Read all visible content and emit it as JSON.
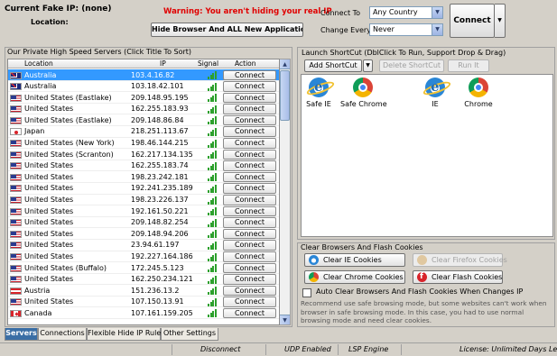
{
  "header": {
    "current_ip_label": "Current Fake IP: (none)",
    "location_label": "Location:",
    "warning": "Warning: You aren't hiding your real IP",
    "hide_browser_button": "Hide Browser And ALL New Application IP",
    "connect_to_label": "Connect To",
    "connect_to_value": "Any Country",
    "change_every_label": "Change Every",
    "change_every_value": "Never",
    "connect_button": "Connect"
  },
  "servers": {
    "title": "Our Private High Speed Servers (Click Title To Sort)",
    "columns": {
      "location": "Location",
      "ip": "IP",
      "signal": "Signal",
      "action": "Action"
    },
    "action_label": "Connect",
    "rows": [
      {
        "flag": "au",
        "location": "Australia",
        "ip": "103.4.16.82",
        "selected": true
      },
      {
        "flag": "au",
        "location": "Australia",
        "ip": "103.18.42.101"
      },
      {
        "flag": "us",
        "location": "United States (Eastlake)",
        "ip": "209.148.95.195"
      },
      {
        "flag": "us",
        "location": "United States",
        "ip": "162.255.183.93"
      },
      {
        "flag": "us",
        "location": "United States (Eastlake)",
        "ip": "209.148.86.84"
      },
      {
        "flag": "jp",
        "location": "Japan",
        "ip": "218.251.113.67"
      },
      {
        "flag": "us",
        "location": "United States (New York)",
        "ip": "198.46.144.215"
      },
      {
        "flag": "us",
        "location": "United States (Scranton)",
        "ip": "162.217.134.135"
      },
      {
        "flag": "us",
        "location": "United States",
        "ip": "162.255.183.74"
      },
      {
        "flag": "us",
        "location": "United States",
        "ip": "198.23.242.181"
      },
      {
        "flag": "us",
        "location": "United States",
        "ip": "192.241.235.189"
      },
      {
        "flag": "us",
        "location": "United States",
        "ip": "198.23.226.137"
      },
      {
        "flag": "us",
        "location": "United States",
        "ip": "192.161.50.221"
      },
      {
        "flag": "us",
        "location": "United States",
        "ip": "209.148.82.254"
      },
      {
        "flag": "us",
        "location": "United States",
        "ip": "209.148.94.206"
      },
      {
        "flag": "us",
        "location": "United States",
        "ip": "23.94.61.197"
      },
      {
        "flag": "us",
        "location": "United States",
        "ip": "192.227.164.186"
      },
      {
        "flag": "us",
        "location": "United States (Buffalo)",
        "ip": "172.245.5.123"
      },
      {
        "flag": "us",
        "location": "United States",
        "ip": "162.250.234.121"
      },
      {
        "flag": "at",
        "location": "Austria",
        "ip": "151.236.13.2"
      },
      {
        "flag": "us",
        "location": "United States",
        "ip": "107.150.13.91"
      },
      {
        "flag": "ca",
        "location": "Canada",
        "ip": "107.161.159.205"
      }
    ]
  },
  "shortcuts": {
    "title": "Launch ShortCut (DblClick To Run, Support Drop & Drag)",
    "add_button": "Add ShortCut",
    "delete_button": "Delete ShortCut",
    "run_button": "Run It",
    "items": [
      {
        "label": "Safe IE",
        "icon": "ie-icon"
      },
      {
        "label": "Safe Chrome",
        "icon": "chrome-icon"
      },
      {
        "label": "IE",
        "icon": "ie-icon"
      },
      {
        "label": "Chrome",
        "icon": "chrome-icon"
      }
    ]
  },
  "clear": {
    "title": "Clear Browsers And Flash Cookies",
    "ie_button": "Clear IE Cookies",
    "firefox_button": "Clear Firefox Cookies",
    "chrome_button": "Clear Chrome Cookies",
    "flash_button": "Clear Flash Cookies",
    "auto_clear_label": "Auto Clear Browsers And Flash Cookies When Changes IP",
    "note": "Recommend use safe browsing mode, but some websites can't work when browser in safe browsing mode. In this case, you had to use normal browsing mode and need clear cookies."
  },
  "tabs": [
    "Servers",
    "Connections",
    "Flexible Hide IP Rules",
    "Other Settings"
  ],
  "status": {
    "connection": "Disconnect",
    "udp": "UDP Enabled",
    "lsp": "LSP Engine",
    "license": "License: Unlimited Days Left"
  },
  "colors": {
    "warning": "#e00000",
    "selected_row": "#3399ff",
    "signal": "#2ca02c",
    "active_tab": "#3a6ea5"
  }
}
